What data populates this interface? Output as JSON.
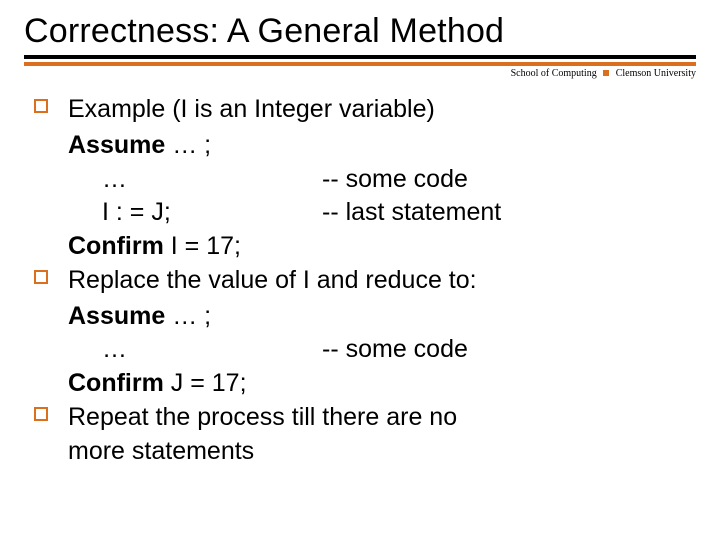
{
  "title": "Correctness: A General Method",
  "affil": {
    "left": "School of Computing",
    "right": "Clemson University"
  },
  "b1": {
    "lead": "Example (I is an Integer variable)",
    "assume_kw": "Assume",
    "assume_rest": " … ;",
    "row1_a": "…",
    "row1_b": "-- some code",
    "row2_a": "I : = J;",
    "row2_b": "-- last statement",
    "confirm_kw": "Confirm",
    "confirm_rest": " I = 17;"
  },
  "b2": {
    "lead": "Replace the value of I and reduce to:",
    "assume_kw": "Assume",
    "assume_rest": " … ;",
    "row1_a": "…",
    "row1_b": "-- some code",
    "confirm_kw": "Confirm",
    "confirm_rest": " J = 17;"
  },
  "b3": {
    "lead_a": "Repeat the process till there are no",
    "lead_b": "more statements"
  }
}
